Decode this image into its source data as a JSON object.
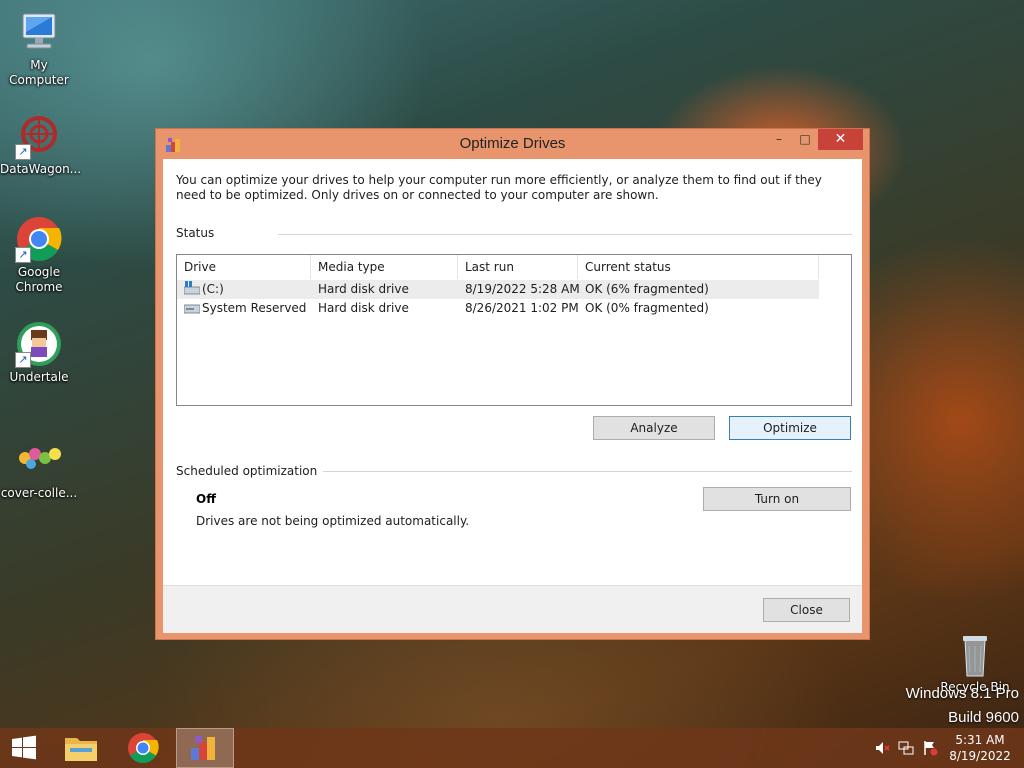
{
  "desktop": {
    "icons": [
      {
        "label": "My Computer",
        "icon": "computer-icon"
      },
      {
        "label": "DataWagon...",
        "icon": "datawagon-icon"
      },
      {
        "label": "Google Chrome",
        "icon": "chrome-icon"
      },
      {
        "label": "Undertale",
        "icon": "undertale-icon"
      },
      {
        "label": "cover-colle...",
        "icon": "cover-collection-icon"
      },
      {
        "label": "Recycle Bin",
        "icon": "recycle-bin-icon"
      }
    ],
    "watermark": {
      "line1": "Windows 8.1 Pro",
      "line2": "Build 9600"
    }
  },
  "window": {
    "title": "Optimize Drives",
    "controls": {
      "minimize": "–",
      "maximize": "□",
      "close": "✕"
    },
    "description": "You can optimize your drives to help your computer run more efficiently, or analyze them to find out if they need to be optimized. Only drives on or connected to your computer are shown.",
    "status_label": "Status",
    "columns": [
      "Drive",
      "Media type",
      "Last run",
      "Current status"
    ],
    "drives": [
      {
        "drive": "(C:)",
        "media_type": "Hard disk drive",
        "last_run": "8/19/2022 5:28 AM",
        "current_status": "OK (6% fragmented)",
        "icon": "windows-drive-icon",
        "selected": true
      },
      {
        "drive": "System Reserved",
        "media_type": "Hard disk drive",
        "last_run": "8/26/2021 1:02 PM",
        "current_status": "OK (0% fragmented)",
        "icon": "hard-drive-icon",
        "selected": false
      }
    ],
    "buttons": {
      "analyze": "Analyze",
      "optimize": "Optimize",
      "turn_on": "Turn on",
      "close": "Close"
    },
    "scheduled": {
      "label": "Scheduled optimization",
      "state": "Off",
      "detail": "Drives are not being optimized automatically."
    }
  },
  "taskbar": {
    "items": [
      "start-button",
      "file-explorer",
      "google-chrome",
      "optimize-drives"
    ],
    "tray": [
      "speaker-muted-icon",
      "network-icon",
      "action-center-flag-icon"
    ],
    "clock": {
      "time": "5:31 AM",
      "date": "8/19/2022"
    }
  },
  "colors": {
    "accent": "#e8956d",
    "close_button": "#c7433a",
    "taskbar": "#6e3719"
  }
}
